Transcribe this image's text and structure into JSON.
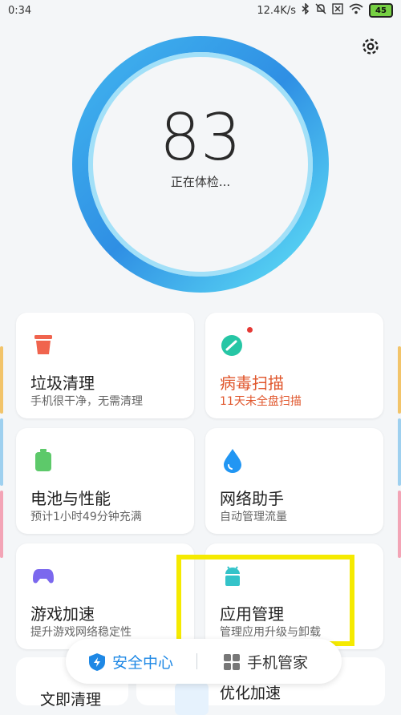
{
  "status_bar": {
    "time": "0:34",
    "speed": "12.4K/s",
    "battery": "45"
  },
  "score": {
    "value": "83",
    "status": "正在体检..."
  },
  "cards": [
    {
      "title": "垃圾清理",
      "subtitle": "手机很干净，无需清理",
      "icon": "trash-icon",
      "color": "#f0644e"
    },
    {
      "title": "病毒扫描",
      "subtitle": "11天未全盘扫描",
      "icon": "virus-scan-icon",
      "color": "#26c6a5",
      "warning": true
    },
    {
      "title": "电池与性能",
      "subtitle": "预计1小时49分钟充满",
      "icon": "battery-icon",
      "color": "#5dc96a"
    },
    {
      "title": "网络助手",
      "subtitle": "自动管理流量",
      "icon": "water-drop-icon",
      "color": "#2196f3"
    },
    {
      "title": "游戏加速",
      "subtitle": "提升游戏网络稳定性",
      "icon": "gamepad-icon",
      "color": "#7b68ee"
    },
    {
      "title": "应用管理",
      "subtitle": "管理应用升级与卸载",
      "icon": "android-icon",
      "color": "#34c3c9"
    }
  ],
  "bottom_nav": {
    "security_label": "安全中心",
    "manager_label": "手机管家"
  },
  "peek": {
    "left_label": "文即清理",
    "right_label": "优化加速"
  },
  "colors": {
    "ring_start": "#3aa0ea",
    "ring_end": "#58d8f4",
    "accent": "#1e88e5",
    "warning": "#e0562c",
    "highlight": "#f5ea00"
  }
}
